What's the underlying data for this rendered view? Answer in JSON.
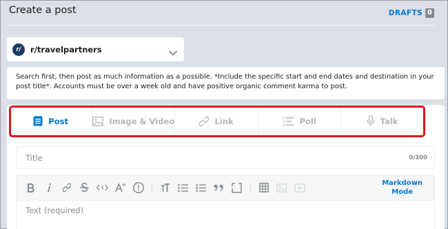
{
  "header": {
    "title": "Create a post",
    "drafts_label": "DRAFTS",
    "drafts_count": "0"
  },
  "community": {
    "avatar_text": "r/",
    "name": "r/travelpartners"
  },
  "rules_text": "Search first, then post as much information as a possible. *Include the specific start and end dates and destination in your post title*. Accounts must be over a week old and have positive organic comment karma to post.",
  "tabs": [
    {
      "label": "Post",
      "icon": "post-icon",
      "active": true
    },
    {
      "label": "Image & Video",
      "icon": "image-icon",
      "active": false
    },
    {
      "label": "Link",
      "icon": "link-icon",
      "active": false
    },
    {
      "label": "Poll",
      "icon": "poll-icon",
      "active": false
    },
    {
      "label": "Talk",
      "icon": "microphone-icon",
      "active": false
    }
  ],
  "title_field": {
    "placeholder": "Title",
    "counter": "0/300"
  },
  "editor": {
    "markdown_mode_line1": "Markdown",
    "markdown_mode_line2": "Mode",
    "body_placeholder": "Text (required)"
  },
  "colors": {
    "accent": "#0079d3",
    "highlight": "#e3121b",
    "background": "#dae0e6"
  }
}
